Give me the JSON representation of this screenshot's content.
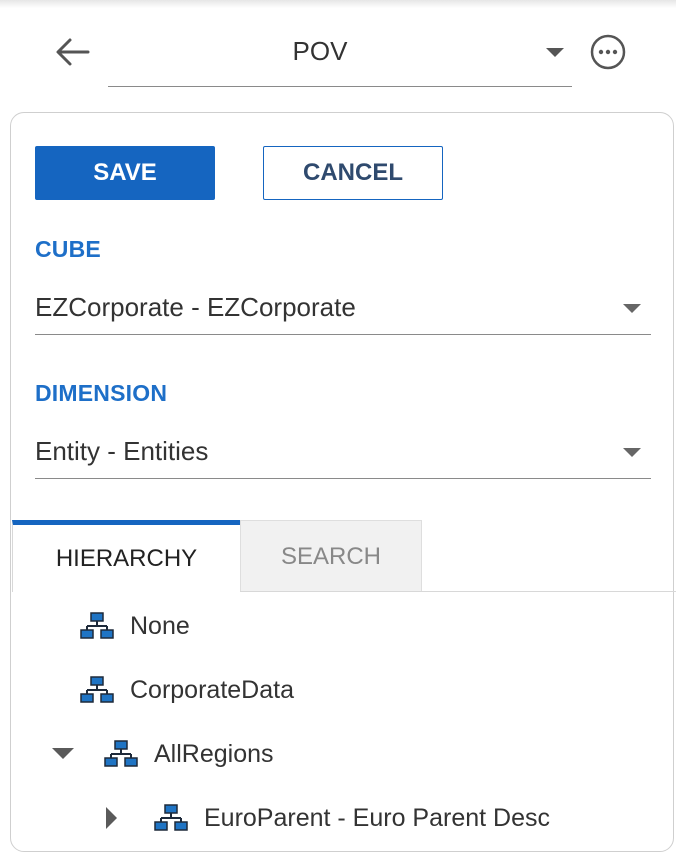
{
  "header": {
    "back_icon": "arrow-left-icon",
    "pov_label": "POV",
    "more_icon": "ellipsis-circle-icon"
  },
  "actions": {
    "save_label": "SAVE",
    "cancel_label": "CANCEL"
  },
  "cube": {
    "label": "CUBE",
    "value": "EZCorporate - EZCorporate"
  },
  "dimension": {
    "label": "DIMENSION",
    "value": "Entity - Entities"
  },
  "tabs": [
    {
      "label": "HIERARCHY",
      "active": true
    },
    {
      "label": "SEARCH",
      "active": false
    }
  ],
  "tree": {
    "icon": "hierarchy-icon",
    "items": [
      {
        "label": "None",
        "expander": "none"
      },
      {
        "label": "CorporateData",
        "expander": "none"
      },
      {
        "label": "AllRegions",
        "expander": "expanded"
      },
      {
        "label": "EuroParent - Euro Parent Desc",
        "expander": "collapsed"
      }
    ]
  },
  "colors": {
    "accent": "#1565c0",
    "label_blue": "#1e6fc8",
    "icon_blue": "#1f74c4",
    "icon_dark": "#1e2a3a"
  }
}
